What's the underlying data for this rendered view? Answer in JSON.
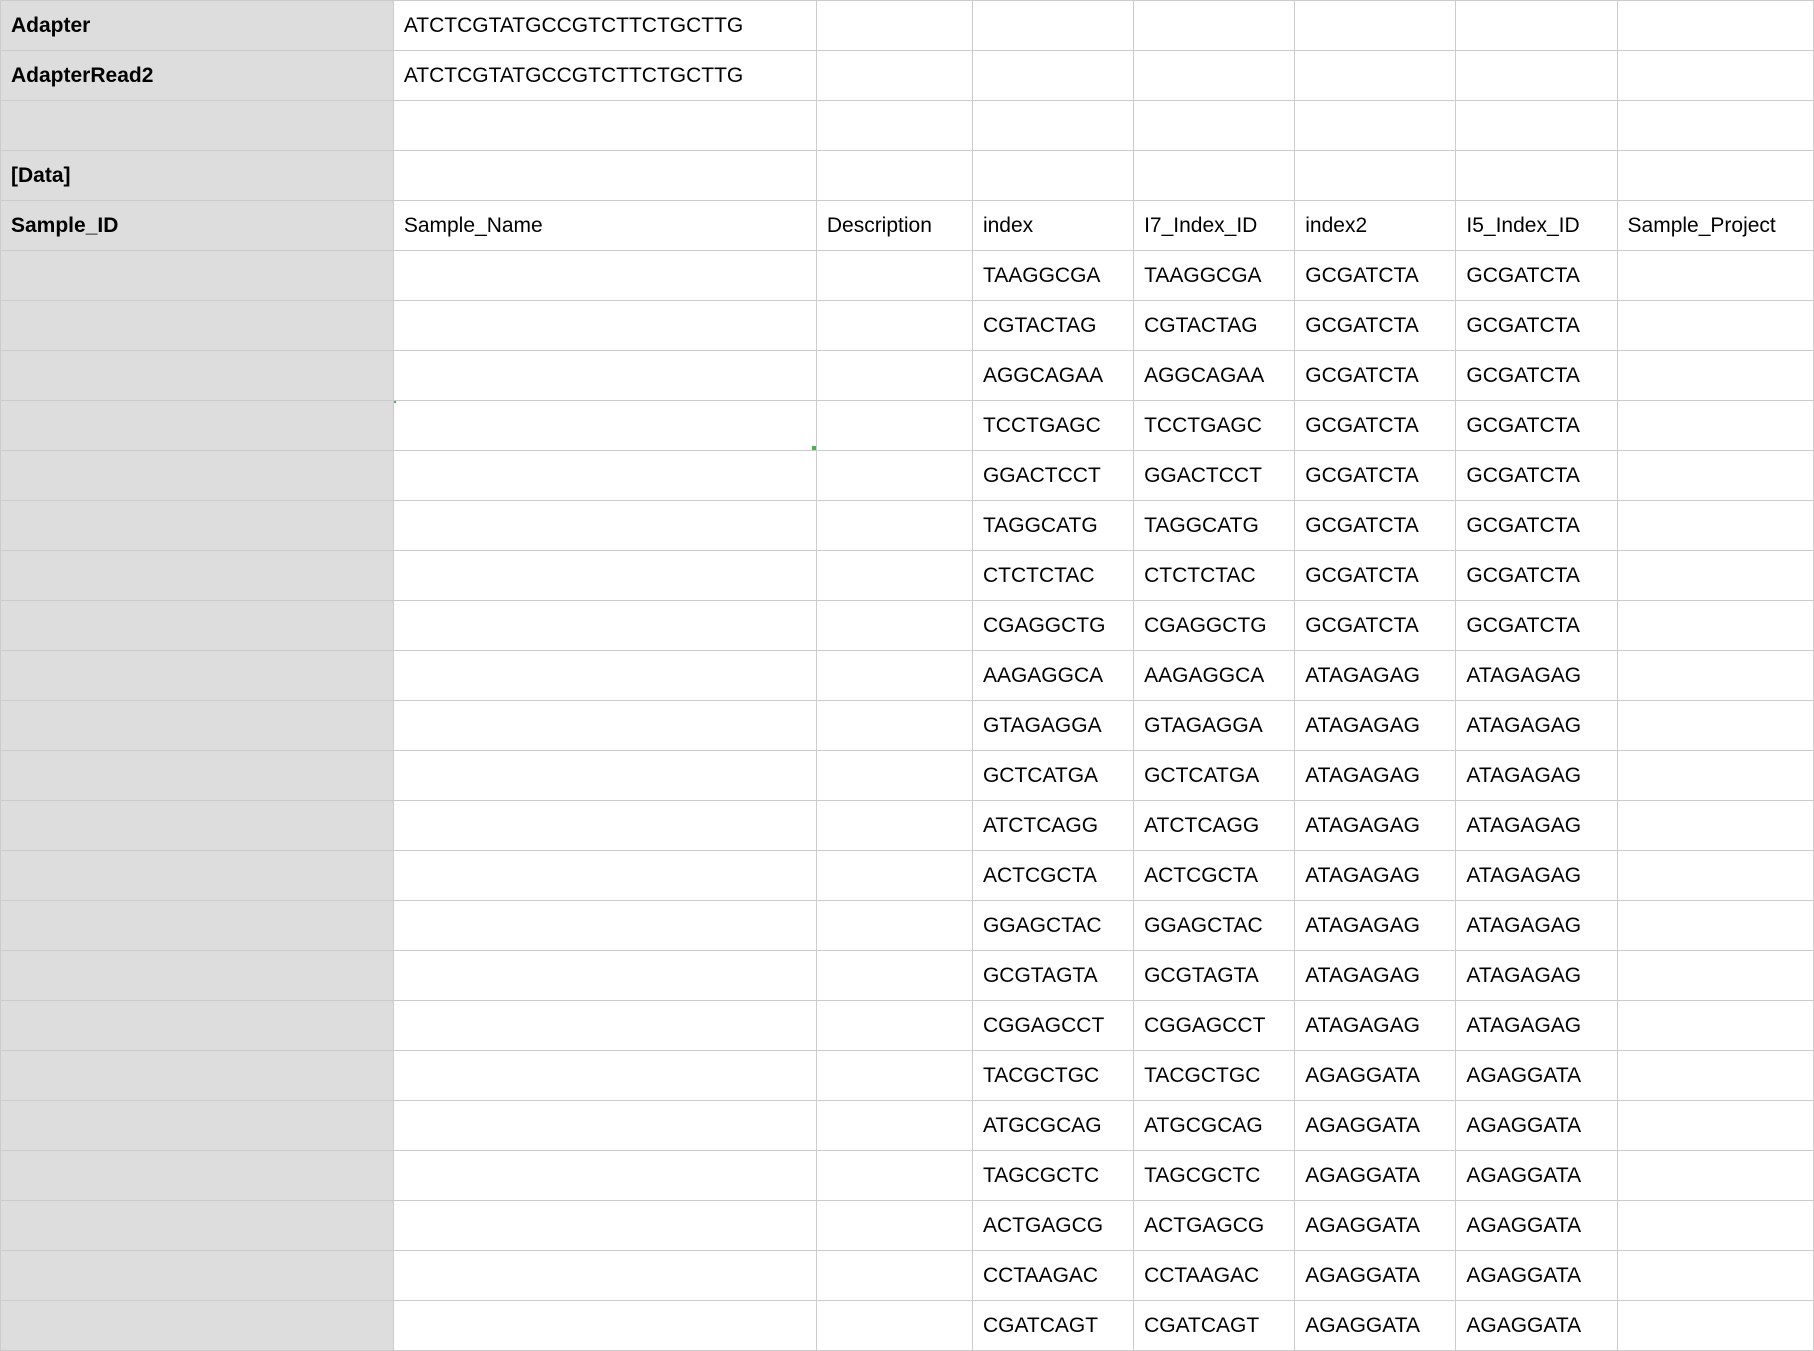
{
  "header_rows": [
    {
      "colA": "Adapter",
      "colB": "ATCTCGTATGCCGTCTTCTGCTTG",
      "bold": true
    },
    {
      "colA": "AdapterRead2",
      "colB": "ATCTCGTATGCCGTCTTCTGCTTG",
      "bold": true
    },
    {
      "colA": "",
      "colB": "",
      "bold": false
    },
    {
      "colA": "[Data]",
      "colB": "",
      "bold": true
    }
  ],
  "column_headers": {
    "colA": "Sample_ID",
    "colB": "Sample_Name",
    "colC": "Description",
    "colD": "index",
    "colE": "I7_Index_ID",
    "colF": "index2",
    "colG": "I5_Index_ID",
    "colH": "Sample_Project"
  },
  "data_rows": [
    {
      "index": "TAAGGCGA",
      "i7": "TAAGGCGA",
      "index2": "GCGATCTA",
      "i5": "GCGATCTA"
    },
    {
      "index": "CGTACTAG",
      "i7": "CGTACTAG",
      "index2": "GCGATCTA",
      "i5": "GCGATCTA"
    },
    {
      "index": "AGGCAGAA",
      "i7": "AGGCAGAA",
      "index2": "GCGATCTA",
      "i5": "GCGATCTA"
    },
    {
      "index": "TCCTGAGC",
      "i7": "TCCTGAGC",
      "index2": "GCGATCTA",
      "i5": "GCGATCTA",
      "selectedB": true
    },
    {
      "index": "GGACTCCT",
      "i7": "GGACTCCT",
      "index2": "GCGATCTA",
      "i5": "GCGATCTA"
    },
    {
      "index": "TAGGCATG",
      "i7": "TAGGCATG",
      "index2": "GCGATCTA",
      "i5": "GCGATCTA"
    },
    {
      "index": "CTCTCTAC",
      "i7": "CTCTCTAC",
      "index2": "GCGATCTA",
      "i5": "GCGATCTA"
    },
    {
      "index": "CGAGGCTG",
      "i7": "CGAGGCTG",
      "index2": "GCGATCTA",
      "i5": "GCGATCTA"
    },
    {
      "index": "AAGAGGCA",
      "i7": "AAGAGGCA",
      "index2": "ATAGAGAG",
      "i5": "ATAGAGAG"
    },
    {
      "index": "GTAGAGGA",
      "i7": "GTAGAGGA",
      "index2": "ATAGAGAG",
      "i5": "ATAGAGAG"
    },
    {
      "index": "GCTCATGA",
      "i7": "GCTCATGA",
      "index2": "ATAGAGAG",
      "i5": "ATAGAGAG"
    },
    {
      "index": "ATCTCAGG",
      "i7": "ATCTCAGG",
      "index2": "ATAGAGAG",
      "i5": "ATAGAGAG"
    },
    {
      "index": "ACTCGCTA",
      "i7": "ACTCGCTA",
      "index2": "ATAGAGAG",
      "i5": "ATAGAGAG"
    },
    {
      "index": "GGAGCTAC",
      "i7": "GGAGCTAC",
      "index2": "ATAGAGAG",
      "i5": "ATAGAGAG"
    },
    {
      "index": "GCGTAGTA",
      "i7": "GCGTAGTA",
      "index2": "ATAGAGAG",
      "i5": "ATAGAGAG"
    },
    {
      "index": "CGGAGCCT",
      "i7": "CGGAGCCT",
      "index2": "ATAGAGAG",
      "i5": "ATAGAGAG"
    },
    {
      "index": "TACGCTGC",
      "i7": "TACGCTGC",
      "index2": "AGAGGATA",
      "i5": "AGAGGATA"
    },
    {
      "index": "ATGCGCAG",
      "i7": "ATGCGCAG",
      "index2": "AGAGGATA",
      "i5": "AGAGGATA"
    },
    {
      "index": "TAGCGCTC",
      "i7": "TAGCGCTC",
      "index2": "AGAGGATA",
      "i5": "AGAGGATA"
    },
    {
      "index": "ACTGAGCG",
      "i7": "ACTGAGCG",
      "index2": "AGAGGATA",
      "i5": "AGAGGATA"
    },
    {
      "index": "CCTAAGAC",
      "i7": "CCTAAGAC",
      "index2": "AGAGGATA",
      "i5": "AGAGGATA"
    },
    {
      "index": "CGATCAGT",
      "i7": "CGATCAGT",
      "index2": "AGAGGATA",
      "i5": "AGAGGATA"
    }
  ]
}
